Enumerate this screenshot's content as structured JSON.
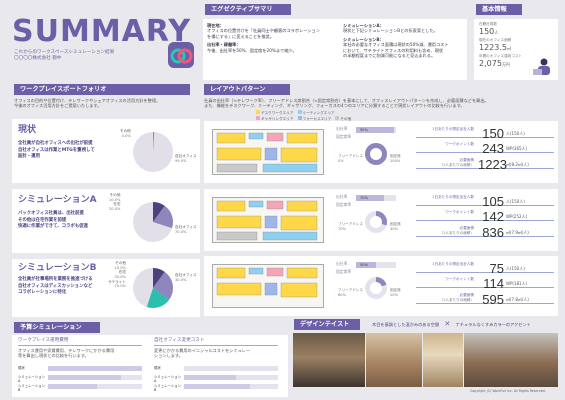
{
  "title": "SUMMARY",
  "subtitle_lines": [
    "これからのワークスペースシミュレーション結果",
    "〇〇〇〇株式会社 御中"
  ],
  "exec": {
    "header": "エグゼクティブサマリ",
    "current_head": "現在地：",
    "current_lines": [
      "オフィスの位置付けを「社員同士や顧客のコラボレーション",
      "を場にする」に変えることを推奨。"
    ],
    "status_head": "出社率・稼働率：",
    "status_lines": [
      "今後、出社率を50%、固定席を20%まで縮少。"
    ],
    "simA_head": "シミュレーションA：",
    "simA_lines": [
      "現状と下記シミュレーションBとの折衷案とした。"
    ],
    "simB_head": "シミュレーションB：",
    "simB_lines": [
      "本社の必要なオフィス面積は現状の50%減、運用コスト",
      "において、サテライトオフィスの利用料も含め、現状",
      "の半額程度までに削減可能になると見込まれる。"
    ]
  },
  "basic": {
    "header": "基本情報",
    "items": [
      {
        "label": "在籍社員数",
        "value": "150",
        "unit": "人"
      },
      {
        "label": "現在のオフィス面積",
        "value": "1223.5",
        "unit": "㎡"
      },
      {
        "label": "年間のオフィス運用コスト",
        "value": "2,075",
        "unit": "万円"
      }
    ]
  },
  "portfolio": {
    "header": "ワークプレイスポートフォリオ",
    "intro": [
      "オフィスの目的や位置付け、テレワークやシェアオフィスの活用方針を整理。",
      "今後のオフィス活用方針をご提案いたします。"
    ],
    "rows": [
      {
        "name": "現状",
        "desc": [
          "全社員が自社オフィスへの出社が前提",
          "自社オフィスは作業とMTGを重視して",
          "設計・運用"
        ],
        "slices": [
          {
            "label": "その他",
            "pct": "0.0%"
          },
          {
            "label": "自社オフィス",
            "pct": "99.0%"
          }
        ]
      },
      {
        "name": "シミュレーションA",
        "desc": [
          "バックオフィス社員は、出社前提",
          "その他は在宅作業を前提",
          "快適に作業ができて、コラボも促進"
        ],
        "slices": [
          {
            "label": "その他",
            "pct": "10.0%"
          },
          {
            "label": "在宅",
            "pct": "20.0%"
          },
          {
            "label": "自社オフィス",
            "pct": "70.0%"
          }
        ]
      },
      {
        "name": "シミュレーションB",
        "desc": [
          "全社員が社事場所を業務を推進づける",
          "自社オフィスはディスカッションなど",
          "コラボレーションに特化"
        ],
        "slices": [
          {
            "label": "その他",
            "pct": "10.0%"
          },
          {
            "label": "在宅",
            "pct": "35.0%"
          },
          {
            "label": "サテライト",
            "pct": "25.0%"
          },
          {
            "label": "自社オフィス",
            "pct": "30.0%"
          }
        ]
      }
    ]
  },
  "layout": {
    "header": "レイアウトパターン",
    "intro": [
      "社員の出社率（≒テレワーク率）、フリーアドレス席割合（≒固定席割合）を基本にして、オフィスレイアウトパターンを作成し、必要面積などを算出。",
      "また、機能をデスクワーク、ミーティング、ギャザリング、フォーカスの4つのエリアに分類することで現状レイアウトの比較を行います。"
    ],
    "legend": [
      "デスクワークエリア",
      "ミーティングエリア",
      "ギャザリングエリア",
      "フォーカスエリア",
      "その他"
    ],
    "legend_colors": [
      "#ffd84a",
      "#8fd0ef",
      "#f4a6b8",
      "#9fb7e8",
      "#c9c9c9"
    ],
    "rate_label": "出社率",
    "fixed_label": "固定席率",
    "free_label": "フリーアドレス",
    "fixed_short": "固定席",
    "stat_labels": [
      "1日あたりの想定出社人数",
      "ワークポイント数",
      "必要面積"
    ],
    "stat_sub": "（1人あたりの面積）",
    "rows": [
      {
        "rate": "95%",
        "rate_v": 0.95,
        "fixed_v": 1.0,
        "fixed_pct": "100%",
        "free_pct": "0%",
        "people": "150",
        "people_u": "人(150人)",
        "wp": "243",
        "wp_u": "WP(365人)",
        "area": "1223",
        "area_u": "㎡(8.2㎡/人)"
      },
      {
        "rate": "70%",
        "rate_v": 0.7,
        "fixed_v": 0.3,
        "fixed_pct": "30%",
        "free_pct": "70%",
        "people": "105",
        "people_u": "人(150人)",
        "wp": "142",
        "wp_u": "WP(252人)",
        "area": "836",
        "area_u": "㎡(7.9㎡/人)"
      },
      {
        "rate": "50%",
        "rate_v": 0.5,
        "fixed_v": 0.2,
        "fixed_pct": "20%",
        "free_pct": "80%",
        "people": "75",
        "people_u": "人(150人)",
        "wp": "114",
        "wp_u": "WP(181人)",
        "area": "595",
        "area_u": "㎡(7.8㎡/人)"
      }
    ]
  },
  "budget": {
    "header": "予算シミュレーション",
    "col1_title": "ワークプレイス運用費用",
    "col1_lines": [
      "オフィス運用や家賃費用、テレワークにかかる費用",
      "等を算出し現状との比較を行います。"
    ],
    "col2_title": "自社オフィス変更コスト",
    "col2_lines": [
      "変更にかかる費用のイニシャルコストをシミュレー",
      "ションします。"
    ],
    "bar_labels": [
      "現状",
      "シミュレーションA",
      "シミュレーションB"
    ],
    "col1_values": [
      1.0,
      0.78,
      0.52
    ],
    "col2_values": [
      0.0,
      0.55,
      0.7
    ]
  },
  "design": {
    "header": "デザインテイスト",
    "point1": "木目を基調とした温かみのある空間",
    "point2": "ナチュラルなくすみカラーのアクセント",
    "cross_icon": "✕"
  },
  "copyright": "Copyright (C) WorkFair Inc. All Rights Reserved."
}
